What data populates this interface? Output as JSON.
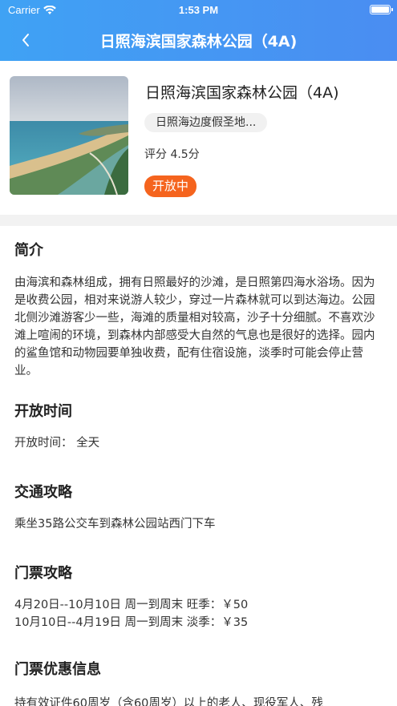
{
  "status_bar": {
    "carrier": "Carrier",
    "time": "1:53 PM"
  },
  "nav": {
    "title": "日照海滨国家森林公园（4A)"
  },
  "place": {
    "name": "日照海滨国家森林公园（4A)",
    "tag": "日照海边度假圣地...",
    "rating": "评分 4.5分",
    "status": "开放中"
  },
  "sections": {
    "intro": {
      "title": "简介",
      "text": "由海滨和森林组成，拥有日照最好的沙滩，是日照第四海水浴场。因为是收费公园，相对来说游人较少，穿过一片森林就可以到达海边。公园北侧沙滩游客少一些，海滩的质量相对较高，沙子十分细腻。不喜欢沙滩上喧闹的环境，到森林内部感受大自然的气息也是很好的选择。园内的鲨鱼馆和动物园要单独收费，配有住宿设施，淡季时可能会停止营业。"
    },
    "hours": {
      "title": "开放时间",
      "text": "开放时间：  全天"
    },
    "transport": {
      "title": "交通攻略",
      "text": "乘坐35路公交车到森林公园站西门下车"
    },
    "tickets": {
      "title": "门票攻略",
      "text": "4月20日--10月10日   周一到周末 旺季：￥50\n10月10日--4月19日  周一到周末 淡季：￥35"
    },
    "discount": {
      "title": "门票优惠信息",
      "text": "持有效证件60周岁（含60周岁）以上的老人、现役军人、残"
    }
  },
  "colors": {
    "header_start": "#3fa2f4",
    "header_end": "#4a8df2",
    "badge": "#f5641e",
    "tag_bg": "#f1f1f1"
  },
  "icons": {
    "back": "chevron-left-icon",
    "wifi": "wifi-icon",
    "battery": "battery-icon"
  }
}
